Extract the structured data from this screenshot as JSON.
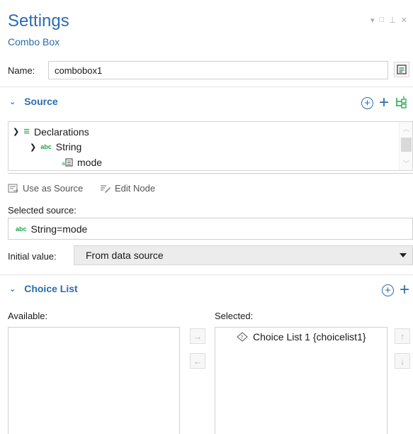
{
  "header": {
    "title": "Settings",
    "subtitle": "Combo Box"
  },
  "name_field": {
    "label": "Name:",
    "value": "combobox1"
  },
  "source_section": {
    "title": "Source",
    "tree": {
      "root": "Declarations",
      "child": "String",
      "grandchild": "mode",
      "abc_tag": "abc"
    },
    "toolbar": {
      "use_as_source": "Use as Source",
      "edit_node": "Edit Node"
    },
    "selected_source_label": "Selected source:",
    "selected_source_value": "String=mode",
    "selected_source_tag": "abc"
  },
  "initial_value": {
    "label": "Initial value:",
    "selected": "From data source"
  },
  "choice_list_section": {
    "title": "Choice List",
    "available_label": "Available:",
    "selected_label": "Selected:",
    "selected_items": [
      "Choice List 1 {choicelist1}"
    ]
  },
  "colors": {
    "accent": "#2a6db0",
    "green": "#1fa34a"
  }
}
